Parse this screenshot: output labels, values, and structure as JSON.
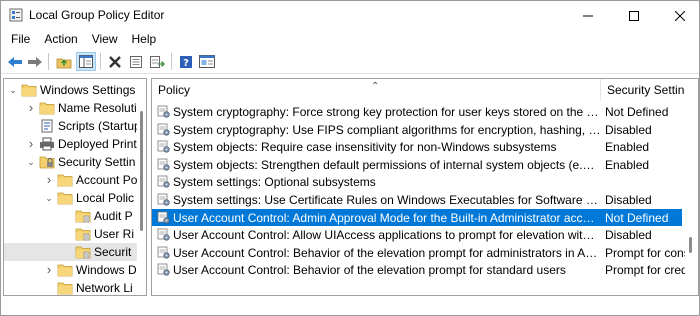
{
  "window": {
    "title": "Local Group Policy Editor"
  },
  "menubar": [
    "File",
    "Action",
    "View",
    "Help"
  ],
  "toolbar": {
    "buttons": [
      "back-icon",
      "forward-icon",
      "up-folder-icon",
      "show-hide-tree-icon",
      "delete-icon",
      "properties-icon",
      "export-list-icon",
      "help-icon",
      "extended-view-icon"
    ],
    "active": "show-hide-tree-icon"
  },
  "tree": {
    "items": [
      {
        "label": "Windows Settings",
        "level": 0,
        "twisty": "expanded",
        "icon": "folder-icon"
      },
      {
        "label": "Name Resoluti",
        "level": 1,
        "twisty": "collapsed",
        "icon": "folder-icon"
      },
      {
        "label": "Scripts (Startup",
        "level": 1,
        "twisty": "none",
        "icon": "scripts-icon"
      },
      {
        "label": "Deployed Print",
        "level": 1,
        "twisty": "collapsed",
        "icon": "printer-icon"
      },
      {
        "label": "Security Settin",
        "level": 1,
        "twisty": "expanded",
        "icon": "security-icon"
      },
      {
        "label": "Account Po",
        "level": 2,
        "twisty": "collapsed",
        "icon": "folder-icon"
      },
      {
        "label": "Local Polic",
        "level": 2,
        "twisty": "expanded",
        "icon": "folder-icon"
      },
      {
        "label": "Audit P",
        "level": 3,
        "twisty": "none",
        "icon": "folder-icon"
      },
      {
        "label": "User Ri",
        "level": 3,
        "twisty": "none",
        "icon": "folder-icon"
      },
      {
        "label": "Securit",
        "level": 3,
        "twisty": "none",
        "icon": "folder-icon",
        "selected": true
      },
      {
        "label": "Windows D",
        "level": 2,
        "twisty": "collapsed",
        "icon": "folder-icon"
      },
      {
        "label": "Network Li",
        "level": 2,
        "twisty": "none",
        "icon": "folder-icon"
      }
    ]
  },
  "list": {
    "columns": {
      "policy": "Policy",
      "setting": "Security Setting"
    },
    "rows": [
      {
        "policy": "System cryptography: Force strong key protection for user keys stored on the computer",
        "setting": "Not Defined"
      },
      {
        "policy": "System cryptography: Use FIPS compliant algorithms for encryption, hashing, and signing",
        "setting": "Disabled"
      },
      {
        "policy": "System objects: Require case insensitivity for non-Windows subsystems",
        "setting": "Enabled"
      },
      {
        "policy": "System objects: Strengthen default permissions of internal system objects (e.g. Symbolic Links)",
        "setting": "Enabled"
      },
      {
        "policy": "System settings: Optional subsystems",
        "setting": ""
      },
      {
        "policy": "System settings: Use Certificate Rules on Windows Executables for Software Restriction Policies",
        "setting": "Disabled"
      },
      {
        "policy": "User Account Control: Admin Approval Mode for the Built-in Administrator account",
        "setting": "Not Defined",
        "selected": true
      },
      {
        "policy": "User Account Control: Allow UIAccess applications to prompt for elevation without using the secure desktop",
        "setting": "Disabled"
      },
      {
        "policy": "User Account Control: Behavior of the elevation prompt for administrators in Admin Approval Mode",
        "setting": "Prompt for consent"
      },
      {
        "policy": "User Account Control: Behavior of the elevation prompt for standard users",
        "setting": "Prompt for credentials"
      }
    ]
  },
  "colors": {
    "selection": "#0078d7",
    "tree_selection": "#e5e5e5",
    "folder": "#e9c35b"
  }
}
